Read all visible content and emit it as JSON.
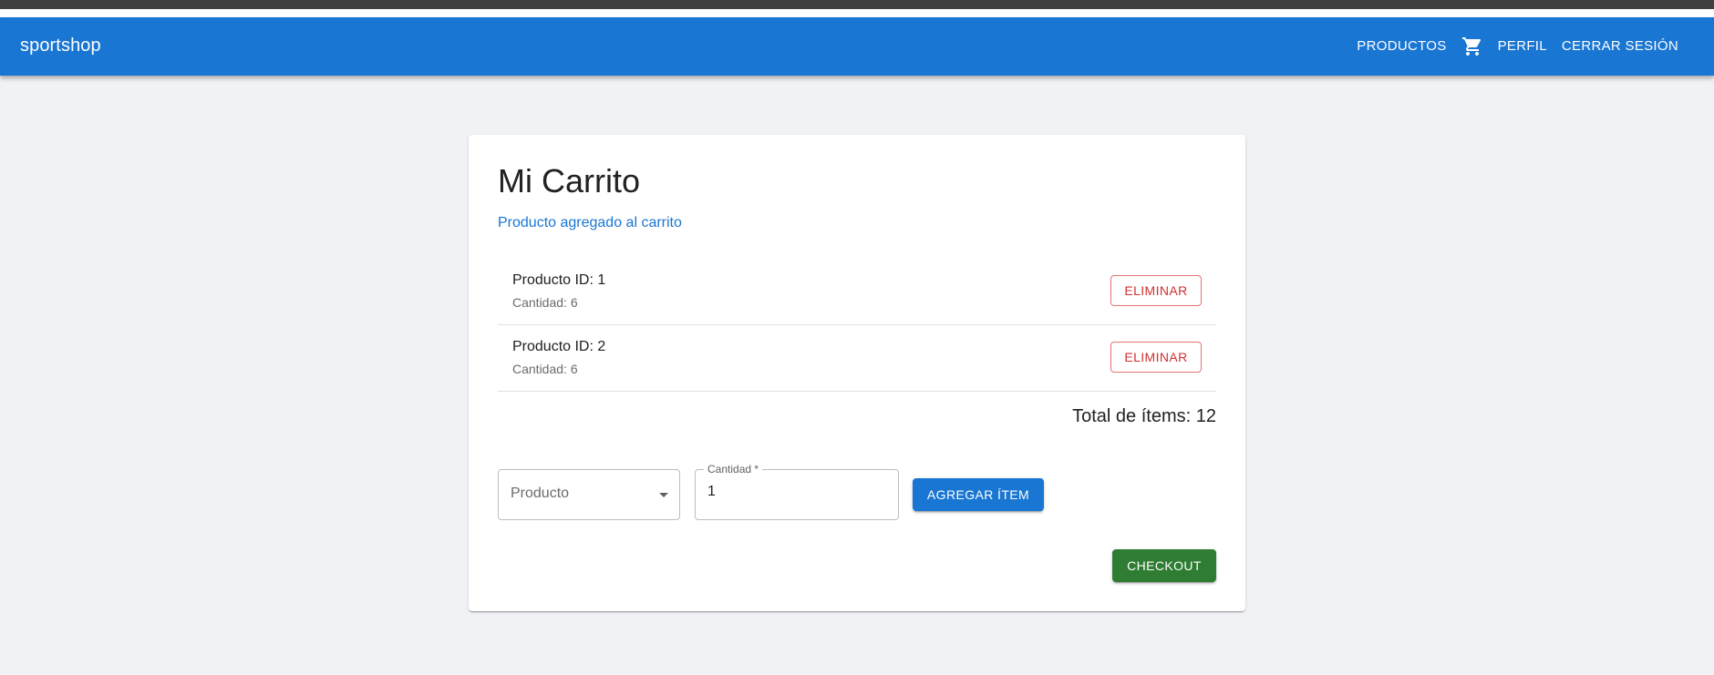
{
  "colors": {
    "primary": "#1976d2",
    "danger": "#d32f2f",
    "success": "#2e7d32",
    "page_background": "#f0f2f5"
  },
  "appbar": {
    "brand": "sportshop",
    "nav": {
      "products": "PRODUCTOS",
      "cart_icon": "shopping-cart-icon",
      "profile": "PERFIL",
      "logout": "CERRAR SESIÓN"
    }
  },
  "cart": {
    "title": "Mi Carrito",
    "message": "Producto agregado al carrito",
    "items": [
      {
        "product": "Producto ID: 1",
        "quantity": "Cantidad: 6",
        "remove_label": "ELIMINAR"
      },
      {
        "product": "Producto ID: 2",
        "quantity": "Cantidad: 6",
        "remove_label": "ELIMINAR"
      }
    ],
    "total": "Total de ítems: 12"
  },
  "form": {
    "product_select": {
      "placeholder": "Producto",
      "icon": "arrow-drop-down-icon"
    },
    "quantity_field": {
      "label": "Cantidad *",
      "value": "1"
    },
    "add_button": "AGREGAR ÍTEM",
    "checkout_button": "CHECKOUT"
  }
}
